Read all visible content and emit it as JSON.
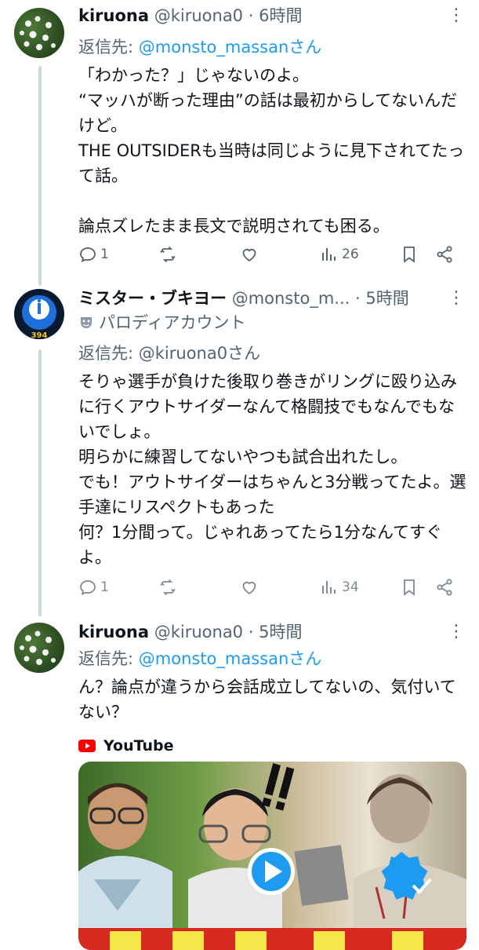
{
  "tweets": [
    {
      "name": "kiruona",
      "handle": "@kiruona0",
      "time": "· 6時間",
      "reply_prefix": "返信先: ",
      "reply_to": "@monsto_massan",
      "reply_suffix": "さん",
      "body": "「わかった？」じゃないのよ。\n“マッハが断った理由”の話は最初からしてないんだけど。\nTHE OUTSIDERも当時は同じように見下されてたって話。\n\n論点ズレたまま長文で説明されても困る。",
      "replies": "1",
      "retweets": "",
      "likes": "",
      "views": "26"
    },
    {
      "name": "ミスター・ブキヨー",
      "handle": "@monsto_m...",
      "time": "· 5時間",
      "avatar_badge": "394",
      "parody_label": "パロディアカウント",
      "reply_prefix": "返信先: ",
      "reply_to": "@kiruona0",
      "reply_suffix": "さん",
      "body": "そりゃ選手が負けた後取り巻きがリングに殴り込みに行くアウトサイダーなんて格闘技でもなんでもないでしょ。\n明らかに練習してないやつも試合出れたし。\nでも！アウトサイダーはちゃんと3分戦ってたよ。選手達にリスペクトもあった\n何？1分間って。じゃれあってたら1分なんてすぐよ。",
      "replies": "1",
      "retweets": "",
      "likes": "",
      "views": "34"
    },
    {
      "name": "kiruona",
      "handle": "@kiruona0",
      "time": "· 5時間",
      "reply_prefix": "返信先: ",
      "reply_to": "@monsto_massan",
      "reply_suffix": "さん",
      "body": "ん？論点が違うから会話成立してないの、気付いてない？",
      "card_source": "YouTube"
    }
  ],
  "colors": {
    "accent": "#1d9bf0",
    "muted": "#536471",
    "youtube": "#ff0000"
  },
  "icons": [
    "more-icon",
    "reply-icon",
    "retweet-icon",
    "like-icon",
    "views-icon",
    "bookmark-icon",
    "share-icon",
    "parody-mask-icon",
    "youtube-icon",
    "play-icon"
  ]
}
